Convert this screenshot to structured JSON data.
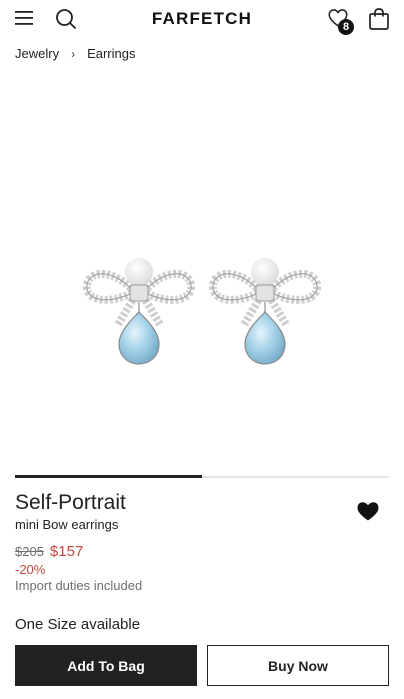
{
  "header": {
    "logo": "FARFETCH",
    "wishlist_count": "8",
    "icons": [
      "menu-icon",
      "search-icon",
      "heart-icon",
      "bag-icon"
    ]
  },
  "breadcrumb": {
    "items": [
      "Jewelry",
      "Earrings"
    ],
    "separator": "›"
  },
  "gallery": {
    "current_slide": 1,
    "total_slides": 2
  },
  "product": {
    "brand": "Self-Portrait",
    "name": "mini Bow earrings",
    "original_price": "$205",
    "sale_price": "$157",
    "discount": "-20%",
    "duties_note": "Import duties included",
    "size_availability": "One Size available"
  },
  "actions": {
    "add_to_bag": "Add To Bag",
    "buy_now": "Buy Now"
  },
  "colors": {
    "sale": "#c4483f",
    "primary": "#222222",
    "muted": "#6f6f6f",
    "gem": "#a8d4ea"
  }
}
